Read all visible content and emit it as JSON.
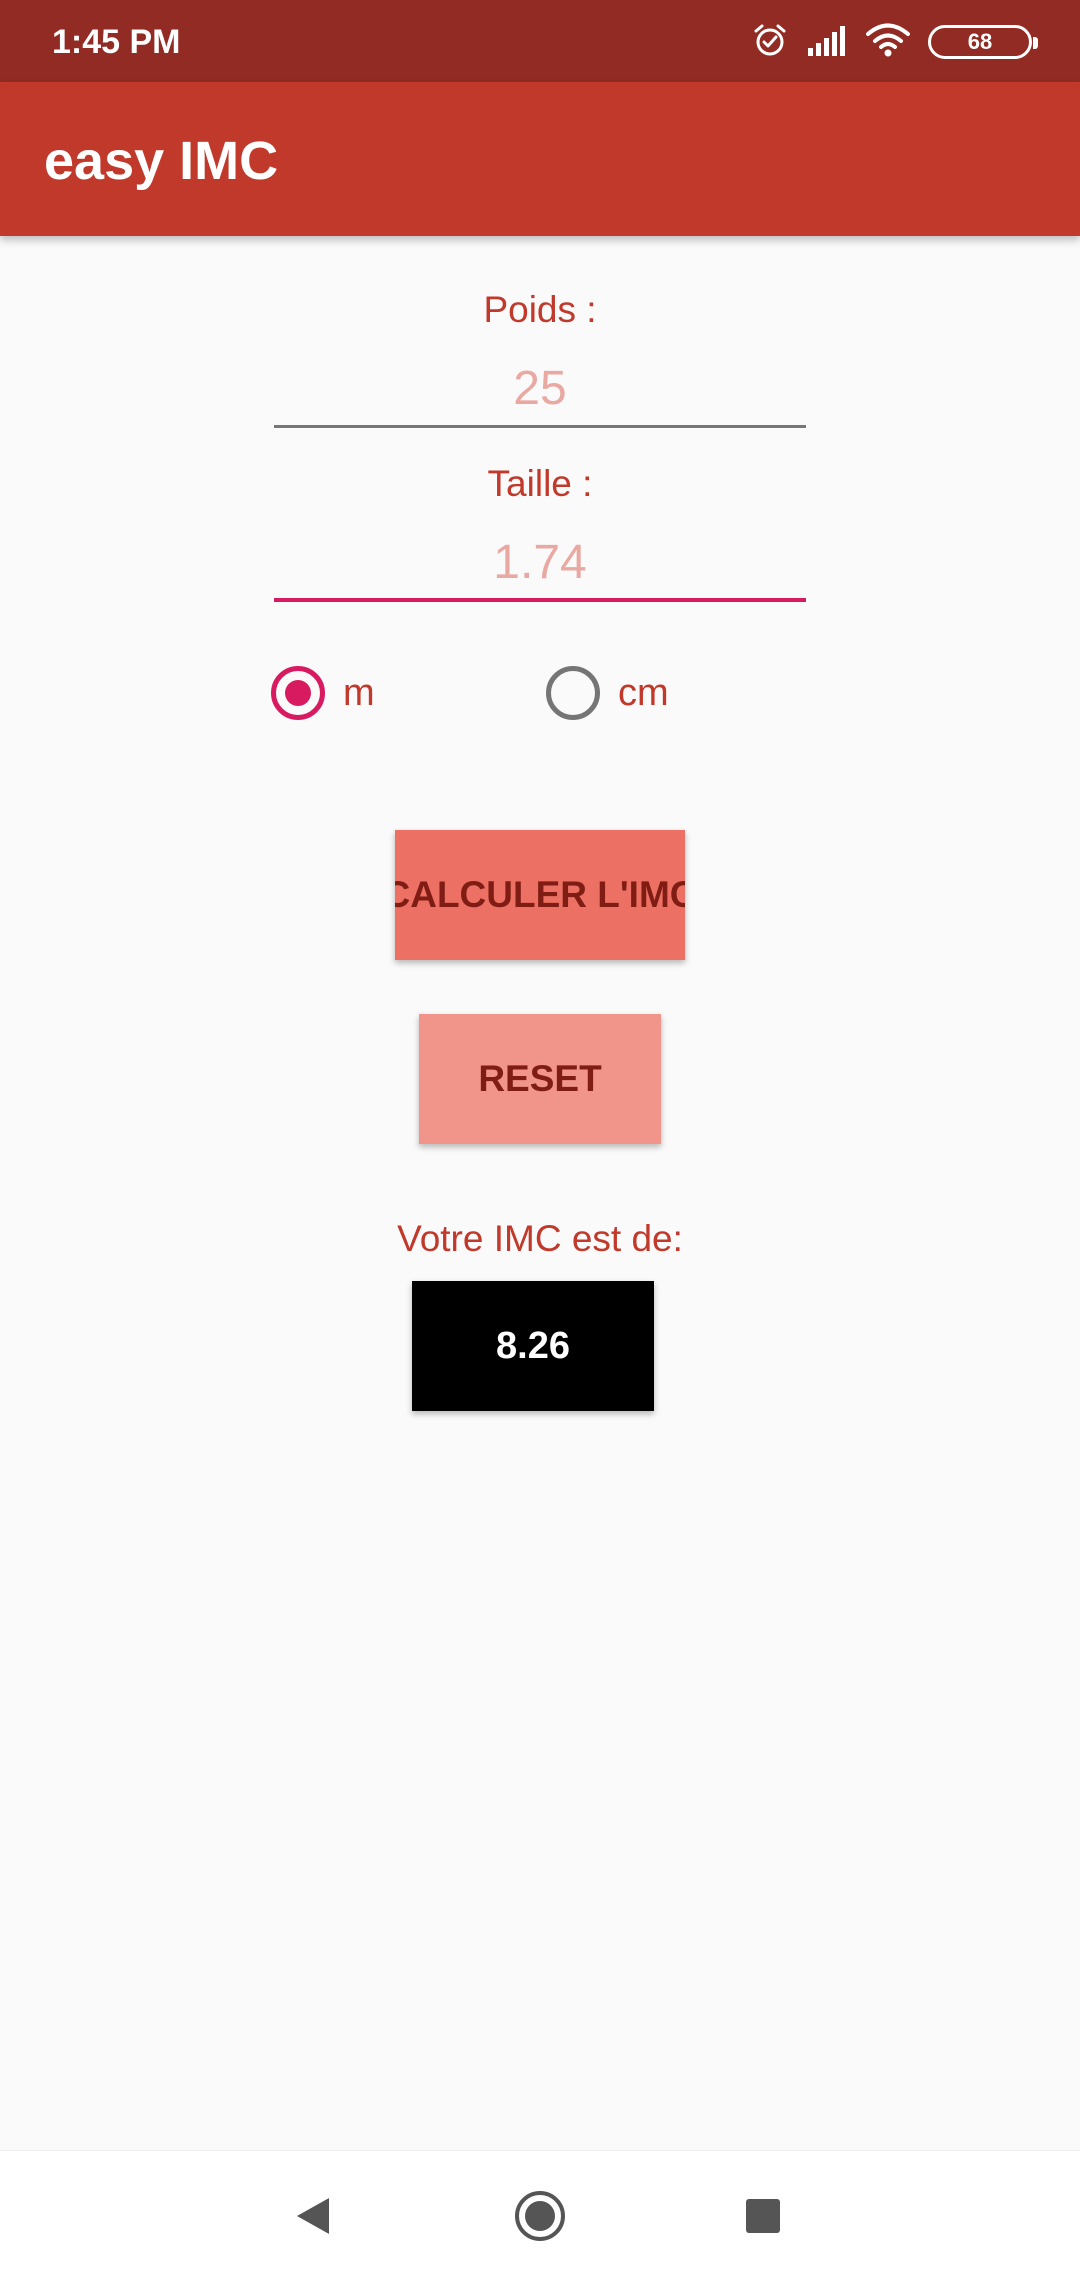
{
  "status_bar": {
    "time": "1:45 PM",
    "battery": "68",
    "icons": [
      "alarm-icon",
      "signal-icon",
      "wifi-icon",
      "battery-icon"
    ]
  },
  "app_bar": {
    "title": "easy IMC"
  },
  "form": {
    "weight_label": "Poids :",
    "weight_placeholder": "25",
    "height_label": "Taille :",
    "height_placeholder": "1.74",
    "unit_options": [
      {
        "label": "m",
        "checked": true
      },
      {
        "label": "cm",
        "checked": false
      }
    ],
    "calculate_label": "CALCULER L'IMC",
    "reset_label": "RESET"
  },
  "result": {
    "label": "Votre IMC est de:",
    "value": "8.26"
  },
  "nav_bar": {
    "icons": [
      "back-icon",
      "home-icon",
      "recents-icon"
    ]
  },
  "colors": {
    "status_bar": "#922b23",
    "app_bar": "#c0392b",
    "accent": "#d81b60",
    "calculate_button": "#ec7063",
    "reset_button": "#f1948a",
    "result_box": "#000000",
    "background": "#fafafa"
  }
}
